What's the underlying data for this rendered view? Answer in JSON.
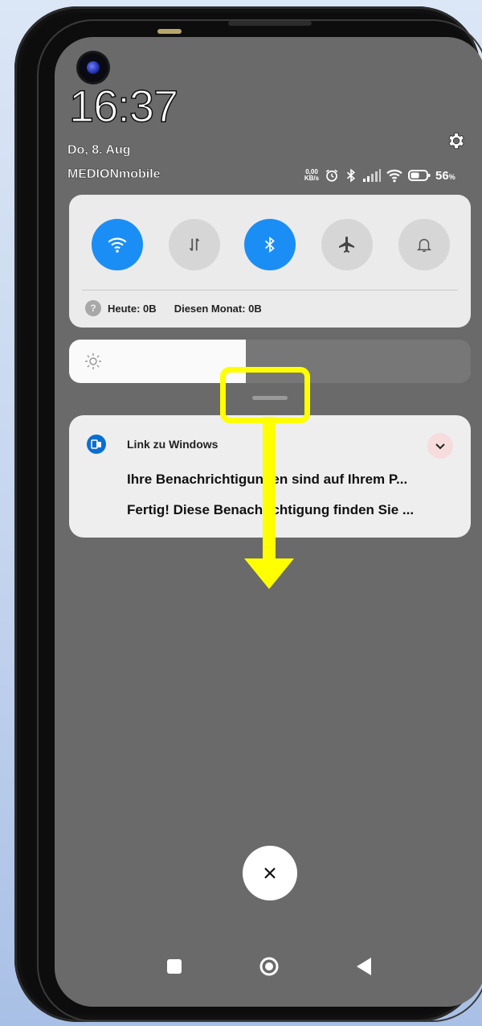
{
  "status_bar": {
    "time": "16:37",
    "date": "Do, 8. Aug",
    "carrier": "MEDIONmobile",
    "net_speed_value": "0,00",
    "net_speed_unit": "KB/s",
    "battery_value": "56",
    "battery_unit": "%",
    "battery_level": 0.56,
    "icons": [
      "alarm-icon",
      "bluetooth-icon",
      "signal-icon",
      "wifi-icon",
      "battery-icon"
    ]
  },
  "quick_settings": {
    "toggles": [
      {
        "name": "wifi",
        "icon": "wifi-icon",
        "state": "on"
      },
      {
        "name": "mobile-data",
        "icon": "mobile-data-icon",
        "state": "off"
      },
      {
        "name": "bluetooth",
        "icon": "bluetooth-icon",
        "state": "on"
      },
      {
        "name": "airplane-mode",
        "icon": "airplane-icon",
        "state": "off"
      },
      {
        "name": "sound",
        "icon": "bell-icon",
        "state": "off"
      }
    ],
    "data_today": "Heute: 0B",
    "data_month": "Diesen Monat: 0B"
  },
  "brightness": {
    "level": 0.44,
    "icon": "sun-icon"
  },
  "notification": {
    "app_name": "Link zu Windows",
    "title": "Ihre Benachrichtigungen sind auf Ihrem P...",
    "body": "Fertig! Diese Benachrichtigung finden Sie ..."
  },
  "annotation": {
    "color": "#ffff00"
  },
  "colors": {
    "accent": "#1b8ef5",
    "shade": "#6a6a6a",
    "panel": "#ebebeb"
  }
}
